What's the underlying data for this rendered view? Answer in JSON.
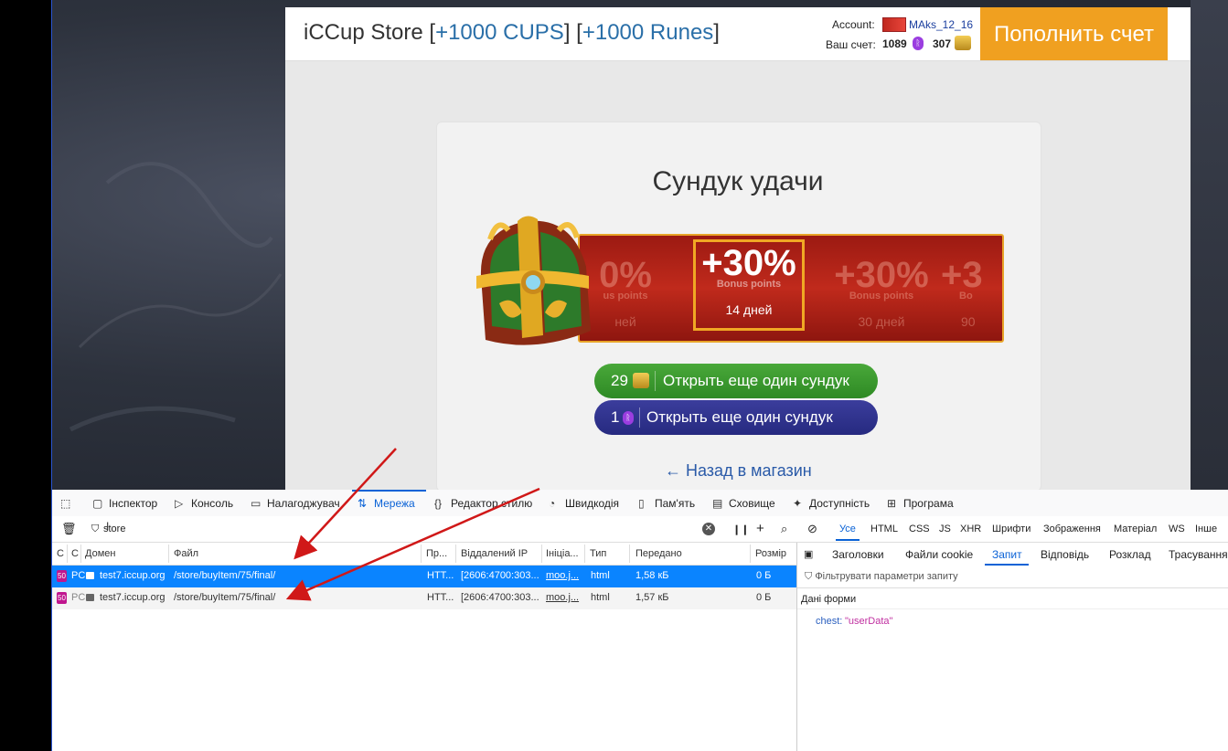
{
  "site": {
    "title_prefix": "iCCup Store ",
    "title_b1": "[",
    "title_cups": "+1000 CUPS",
    "title_b2": "] [",
    "title_runes": "+1000 Runes",
    "title_b3": "]",
    "account_label": "Account:",
    "username": "MAks_12_16",
    "balance_label": "Ваш счет:",
    "runes_balance": "1089",
    "cups_balance": "307",
    "rune_glyph": "ᚱ",
    "topup_label": "Пополнить счет"
  },
  "card": {
    "title": "Сундук удачи",
    "rewards": [
      {
        "pct": "0%",
        "sub": "us points",
        "days": "ней"
      },
      {
        "pct": "+30%",
        "sub": "Bonus points",
        "days": "14 дней"
      },
      {
        "pct": "+30%",
        "sub": "Bonus points",
        "days": "30 дней"
      },
      {
        "pct": "+3",
        "sub": "Bo",
        "days": "90"
      }
    ],
    "btn_cups_count": "29",
    "btn_runes_count": "1",
    "btn_cups_label": "Открыть еще один сундук",
    "btn_runes_label": "Открыть еще один сундук",
    "back_label": "← Назад в магазин"
  },
  "devtools": {
    "tabs": [
      "Інспектор",
      "Консоль",
      "Налагоджувач",
      "Мережа",
      "Редактор стилю",
      "Швидкодія",
      "Пам'ять",
      "Сховище",
      "Доступність",
      "Програма"
    ],
    "filter_value": "store",
    "type_filters": [
      "Усе",
      "HTML",
      "CSS",
      "JS",
      "XHR",
      "Шрифти",
      "Зображення",
      "Матеріал",
      "WS",
      "Інше"
    ],
    "columns": [
      "С",
      "С",
      "Домен",
      "Файл",
      "Пр...",
      "Віддалений IP",
      "Ініціа...",
      "Тип",
      "Передано",
      "Розмір"
    ],
    "rows": [
      {
        "status": "50",
        "method": "PC",
        "domain": "test7.iccup.org",
        "file": "/store/buyItem/75/final/",
        "proto": "HTT...",
        "ip": "[2606:4700:303...",
        "init": "moo.j...",
        "type": "html",
        "transferred": "1,58 кБ",
        "size": "0 Б"
      },
      {
        "status": "50",
        "method": "PC",
        "domain": "test7.iccup.org",
        "file": "/store/buyItem/75/final/",
        "proto": "HTT...",
        "ip": "[2606:4700:303...",
        "init": "moo.j...",
        "type": "html",
        "transferred": "1,57 кБ",
        "size": "0 Б"
      }
    ],
    "side_tabs": [
      "Заголовки",
      "Файли cookie",
      "Запит",
      "Відповідь",
      "Розклад",
      "Трасування"
    ],
    "side_filter_placeholder": "Фільтрувати параметри запиту",
    "form_title": "Дані форми",
    "form_key": "chest:",
    "form_value": "\"userData\""
  },
  "colors": {
    "accent": "#0a62d6",
    "topup": "#f0a020",
    "green_btn": "#3a9a2e",
    "purple_btn": "#30338e",
    "arrow": "#d01818"
  }
}
